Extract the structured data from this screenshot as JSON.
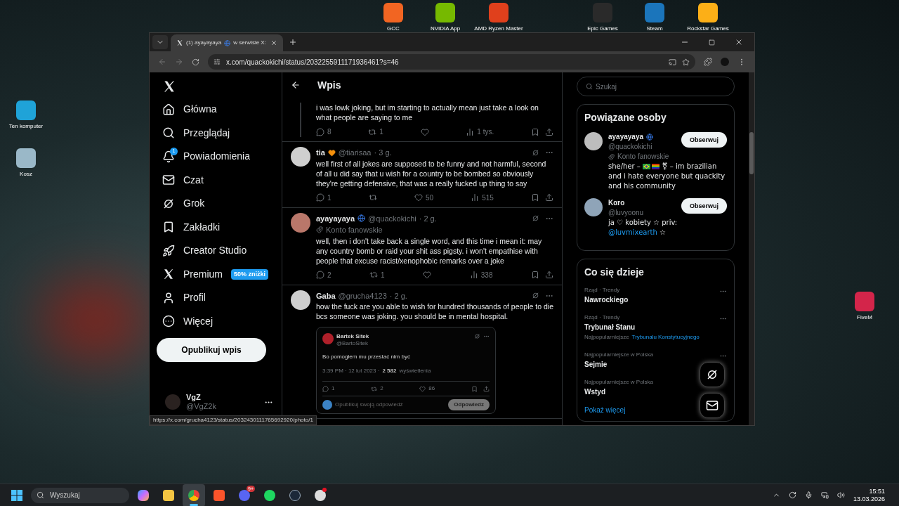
{
  "desktop_icons": [
    {
      "label": "GCC",
      "color": "#f26522"
    },
    {
      "label": "NVIDIA App",
      "color": "#76b900"
    },
    {
      "label": "AMD Ryzen Master",
      "color": "#e0401c"
    },
    {
      "label": "Epic Games",
      "color": "#2a2a2a"
    },
    {
      "label": "Steam",
      "color": "#1b75bb"
    },
    {
      "label": "Rockstar Games",
      "color": "#fcaf17"
    },
    {
      "label": "Ten komputer",
      "color": "#1fa3d8"
    },
    {
      "label": "Kosz",
      "color": "#9ab8c8"
    },
    {
      "label": "FiveM",
      "color": "#d3254a"
    }
  ],
  "browser": {
    "tab": {
      "title": "(1) ayayayaya",
      "title_after": "w serwisie X:"
    },
    "url": "x.com/quackokichi/status/2032255911171936461?s=46",
    "status_url": "https://x.com/grucha4123/status/2032430111765692920/photo/1"
  },
  "sidebar": {
    "items": [
      {
        "kind": "home",
        "label": "Główna"
      },
      {
        "kind": "search",
        "label": "Przeglądaj"
      },
      {
        "kind": "bell",
        "label": "Powiadomienia",
        "badge": "1"
      },
      {
        "kind": "mail",
        "label": "Czat"
      },
      {
        "kind": "grok",
        "label": "Grok"
      },
      {
        "kind": "bookmark",
        "label": "Zakładki"
      },
      {
        "kind": "rocket",
        "label": "Creator Studio"
      },
      {
        "kind": "x",
        "label": "Premium",
        "tag": "50% zniżki"
      },
      {
        "kind": "user",
        "label": "Profil"
      },
      {
        "kind": "more",
        "label": "Więcej"
      }
    ],
    "post_button": "Opublikuj wpis",
    "account": {
      "name": "VgZ",
      "handle": "@VgZ2k"
    }
  },
  "header": {
    "title": "Wpis"
  },
  "posts": [
    {
      "continued": true,
      "text": "i was lowk joking, but im starting to actually mean just take a look on what people are saying to me",
      "stats": {
        "replies": "8",
        "reposts": "1",
        "views": "1 tys."
      }
    },
    {
      "name": "tia",
      "name_heart": true,
      "handle": "@tiarisaa",
      "time": "· 3 g.",
      "text": "well first of all jokes are supposed to be funny and not harmful, second of all u did say that u wish for a country to be bombed so obviously they're getting defensive, that was a really fucked up thing to say",
      "stats": {
        "replies": "1",
        "likes": "50",
        "views": "515"
      }
    },
    {
      "name": "ayayayaya",
      "globe": true,
      "handle": "@quackokichi",
      "time": "· 2 g.",
      "label": "Konto fanowskie",
      "text": "well, then i don't take back a single word, and this time i mean it: may any country bomb or raid your shit ass pigsty. i won't empathise with people that excuse racist/xenophobic remarks over a joke",
      "stats": {
        "replies": "2",
        "reposts": "1",
        "views": "338"
      }
    },
    {
      "name": "Gaba",
      "handle": "@grucha4123",
      "time": "· 2 g.",
      "text": "how the fuck are you able to wish for hundred thousands of people to die bcs someone was joking. you should be in mental hospital.",
      "embed": {
        "name": "Bartek Sitek",
        "handle": "@BartoSitek",
        "text": "Bo pomogłem mu przestać nim być",
        "meta": "3:39 PM · 12 lut 2023 ·",
        "views": "2 582",
        "views_label": "wyświetlenia",
        "stats": {
          "replies": "1",
          "reposts": "2",
          "likes": "86"
        },
        "reply_placeholder": "Opublikuj swoją odpowiedź",
        "reply_button": "Odpowiedz"
      }
    }
  ],
  "right": {
    "search_placeholder": "Szukaj",
    "related": {
      "title": "Powiązane osoby",
      "people": [
        {
          "name": "ayayayaya",
          "globe": true,
          "handle": "@quackokichi",
          "label": "Konto fanowskie",
          "bio_before": "she/her –",
          "bio_after": "⚧ – im brazilian and i hate everyone but quackity and his community",
          "flags": true,
          "button": "Obserwuj"
        },
        {
          "name": "Kαro",
          "handle": "@luvyoonu",
          "bio_before": "ja ♡ kobiety ☆ priv:",
          "bio_link": "@luvmixearth",
          "bio_after": "☆",
          "button": "Obserwuj"
        }
      ]
    },
    "trends": {
      "title": "Co się dzieje",
      "items": [
        {
          "context": "Rząd · Trendy",
          "topic": "Nawrockiego",
          "more": true
        },
        {
          "context": "Rząd · Trendy",
          "topic": "Trybunał Stanu",
          "more": true,
          "related_label": "Najpopularniejsze",
          "related_link": "Trybunału Konstytucyjnego"
        },
        {
          "context": "Najpopularniejsze w Polska",
          "topic": "Sejmie",
          "more": true
        },
        {
          "context": "Najpopularniejsze w Polska",
          "topic": "Wstyd",
          "more": false
        }
      ],
      "show_more": "Pokaż więcej"
    }
  },
  "taskbar": {
    "search_placeholder": "Wyszukaj",
    "apps": [
      {
        "kind": "copilot",
        "active": false
      },
      {
        "kind": "folder",
        "active": false
      },
      {
        "kind": "chrome",
        "active": true
      },
      {
        "kind": "brave",
        "active": false
      },
      {
        "kind": "discord",
        "active": false,
        "badge": "9+"
      },
      {
        "kind": "spotify",
        "active": false
      },
      {
        "kind": "steam",
        "active": false
      },
      {
        "kind": "app",
        "active": false,
        "dot": true
      }
    ],
    "time": "15:51",
    "date": "13.03.2026"
  }
}
